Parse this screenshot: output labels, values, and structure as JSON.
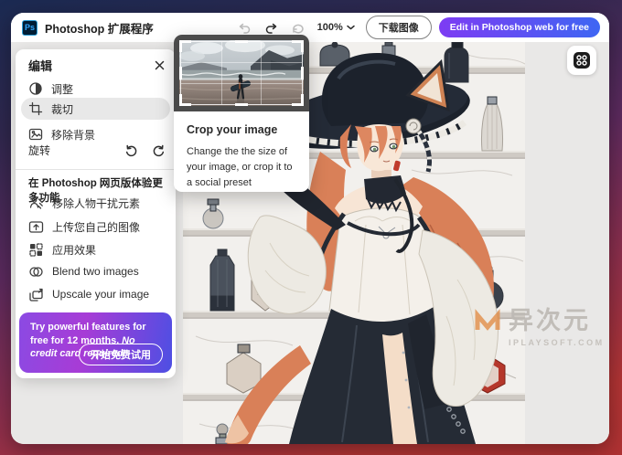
{
  "app": {
    "title": "Photoshop 扩展程序",
    "logo": "Ps"
  },
  "toolbar": {
    "zoom_level": "100%",
    "download_label": "下载图像",
    "edit_label": "Edit in Photoshop web for free"
  },
  "panel": {
    "title": "编辑",
    "tools": [
      {
        "label": "调整",
        "icon": "adjust-icon"
      },
      {
        "label": "裁切",
        "icon": "crop-icon",
        "selected": true
      },
      {
        "label": "移除背景",
        "icon": "remove-background-icon"
      }
    ],
    "rotate_label": "旋转",
    "more_title": "在 Photoshop 网页版体验更多功能",
    "more_items": [
      {
        "label": "移除人物干扰元素",
        "icon": "remove-people-icon"
      },
      {
        "label": "上传您自己的图像",
        "icon": "upload-image-icon"
      },
      {
        "label": "应用效果",
        "icon": "apply-effects-icon"
      },
      {
        "label": "Blend two images",
        "icon": "blend-images-icon"
      },
      {
        "label": "Upscale your image",
        "icon": "upscale-image-icon"
      }
    ],
    "promo": {
      "line1": "Try powerful features for free for 12 months. ",
      "line2_italic": "No credit card required.",
      "button": "开始免费试用"
    }
  },
  "tooltip": {
    "title": "Crop your image",
    "body": "Change the the size of your image, or crop it to a social preset"
  },
  "watermark": {
    "text": "异次元",
    "domain": "IPLAYSOFT.COM"
  },
  "colors": {
    "accent_gradient_start": "#7d3cf3",
    "accent_gradient_end": "#3e66f3",
    "promo_purple": "#8b4ae3",
    "promo_blue": "#4d4fe3",
    "ps_blue": "#31a8ff",
    "canvas_bg": "#e9e8e7"
  }
}
